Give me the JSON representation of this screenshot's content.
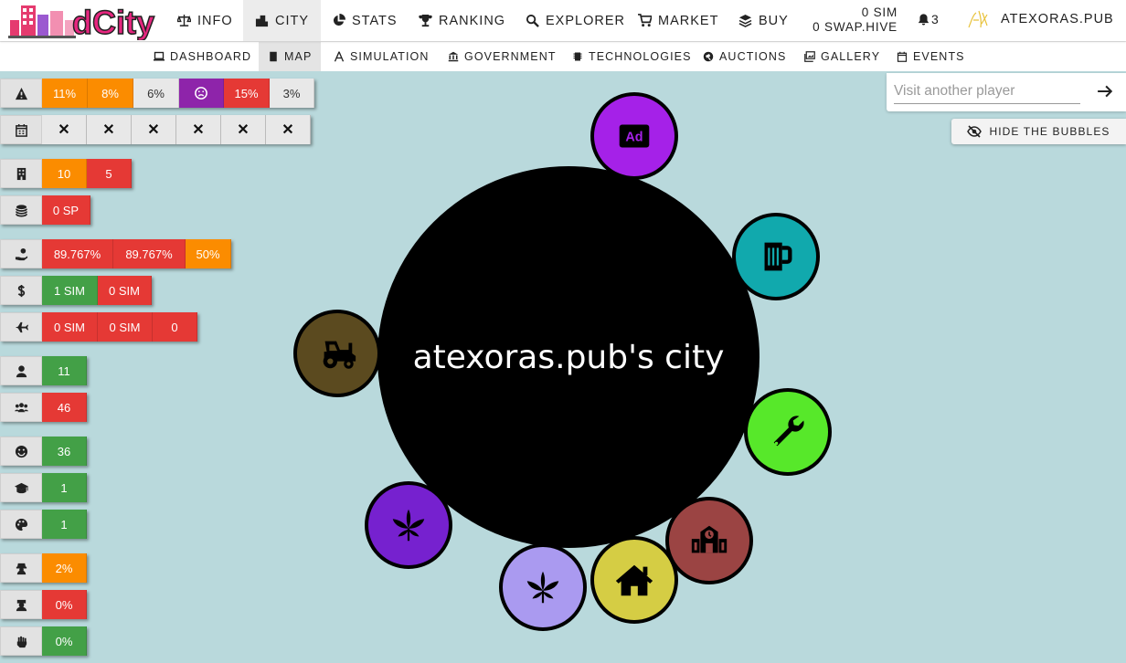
{
  "header": {
    "logo_text": "dCity",
    "nav": [
      {
        "label": "INFO",
        "icon": "scale-icon"
      },
      {
        "label": "CITY",
        "icon": "city-icon",
        "active": true
      },
      {
        "label": "STATS",
        "icon": "pie-chart-icon"
      },
      {
        "label": "RANKING",
        "icon": "trophy-icon"
      },
      {
        "label": "EXPLORER",
        "icon": "search-icon"
      },
      {
        "label": "MARKET",
        "icon": "cart-icon"
      },
      {
        "label": "BUY",
        "icon": "layers-icon"
      }
    ],
    "wallet": {
      "sim": "0 SIM",
      "swap_hive": "0 SWAP.HIVE"
    },
    "notifications": "3",
    "username": "ATEXORAS.PUB"
  },
  "subnav": [
    {
      "label": "DASHBOARD",
      "icon": "laptop-icon"
    },
    {
      "label": "MAP",
      "icon": "book-icon",
      "active": true
    },
    {
      "label": "SIMULATION",
      "icon": "drafting-icon"
    },
    {
      "label": "GOVERNMENT",
      "icon": "landmark-icon"
    },
    {
      "label": "TECHNOLOGIES",
      "icon": "chip-icon"
    },
    {
      "label": "AUCTIONS",
      "icon": "gavel-icon"
    },
    {
      "label": "GALLERY",
      "icon": "images-icon"
    },
    {
      "label": "EVENTS",
      "icon": "calendar-icon"
    }
  ],
  "stats": {
    "risks": {
      "icon": "warning-icon",
      "values": [
        "11%",
        "8%",
        "6%",
        "15%",
        "3%"
      ]
    },
    "events": {
      "icon": "calendar-icon",
      "values": [
        "✕",
        "✕",
        "✕",
        "✕",
        "✕",
        "✕"
      ]
    },
    "buildings": {
      "icon": "building-icon",
      "values": [
        "10",
        "5"
      ]
    },
    "sp": {
      "icon": "coins-icon",
      "values": [
        "0 SP"
      ]
    },
    "income": {
      "icon": "hand-coin-icon",
      "values": [
        "89.767%",
        "89.767%",
        "50%"
      ]
    },
    "sim": {
      "icon": "dollar-icon",
      "values": [
        "1 SIM",
        "0 SIM"
      ]
    },
    "travel": {
      "icon": "plane-icon",
      "values": [
        "0 SIM",
        "0 SIM",
        "0"
      ]
    },
    "population": {
      "icon": "user-icon",
      "values": [
        "11"
      ]
    },
    "workers": {
      "icon": "users-icon",
      "values": [
        "46"
      ]
    },
    "happiness": {
      "icon": "smile-icon",
      "values": [
        "36"
      ]
    },
    "education": {
      "icon": "graduation-icon",
      "values": [
        "1"
      ]
    },
    "culture": {
      "icon": "palette-icon",
      "values": [
        "1"
      ]
    },
    "crime": {
      "icon": "thief-icon",
      "values": [
        "2%"
      ]
    },
    "unemployment": {
      "icon": "worker-icon",
      "values": [
        "0%"
      ]
    },
    "protest": {
      "icon": "fist-icon",
      "values": [
        "0%"
      ]
    }
  },
  "visit": {
    "placeholder": "Visit another player"
  },
  "hide_bubbles": "HIDE THE BUBBLES",
  "city": {
    "title": "atexoras.pub's city"
  },
  "bubbles": [
    {
      "name": "ad-icon",
      "color": "#a521e8"
    },
    {
      "name": "beer-icon",
      "color": "#11a9ad"
    },
    {
      "name": "tractor-icon",
      "color": "#5b4a1f"
    },
    {
      "name": "wrench-icon",
      "color": "#57e82a"
    },
    {
      "name": "leaf-icon",
      "color": "#7621cf"
    },
    {
      "name": "school-icon",
      "color": "#9b4443"
    },
    {
      "name": "leaf-icon",
      "color": "#aa9af0"
    },
    {
      "name": "home-icon",
      "color": "#d5cd44"
    }
  ],
  "colors": {
    "background": "#b9d9dc",
    "orange": "#fb8c00",
    "red": "#e53935",
    "green": "#43a047",
    "purple": "#8e24aa"
  }
}
